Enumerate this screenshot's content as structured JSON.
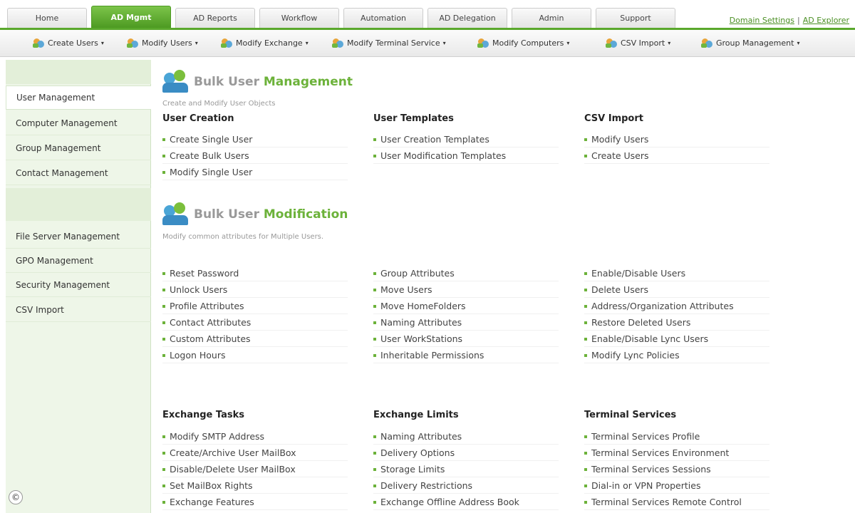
{
  "top_tabs": [
    {
      "label": "Home",
      "active": false
    },
    {
      "label": "AD Mgmt",
      "active": true
    },
    {
      "label": "AD Reports",
      "active": false
    },
    {
      "label": "Workflow",
      "active": false
    },
    {
      "label": "Automation",
      "active": false
    },
    {
      "label": "AD Delegation",
      "active": false
    },
    {
      "label": "Admin",
      "active": false
    },
    {
      "label": "Support",
      "active": false
    }
  ],
  "top_links": {
    "domain_settings": "Domain Settings",
    "separator": "|",
    "ad_explorer": "AD Explorer"
  },
  "toolbar": [
    {
      "label": "Create Users"
    },
    {
      "label": "Modify Users"
    },
    {
      "label": "Modify Exchange"
    },
    {
      "label": "Modify Terminal Service"
    },
    {
      "label": "Modify Computers"
    },
    {
      "label": "CSV Import"
    },
    {
      "label": "Group Management"
    }
  ],
  "caret": "▾",
  "sidebar": {
    "group1": [
      "User Management",
      "Computer Management",
      "Group Management",
      "Contact Management"
    ],
    "group2": [
      "File Server Management",
      "GPO Management",
      "Security Management",
      "CSV Import"
    ]
  },
  "section1": {
    "title_plain": "Bulk User ",
    "title_highlight": "Management",
    "subtitle": "Create and Modify User Objects",
    "columns": [
      {
        "heading": "User Creation",
        "links": [
          "Create Single User",
          "Create Bulk Users",
          "Modify Single User"
        ]
      },
      {
        "heading": "User Templates",
        "links": [
          "User Creation Templates",
          "User Modification Templates"
        ]
      },
      {
        "heading": "CSV Import",
        "links": [
          "Modify Users",
          "Create Users"
        ]
      }
    ]
  },
  "section2": {
    "title_plain": "Bulk User ",
    "title_highlight": "Modification",
    "subtitle": "Modify common attributes for Multiple Users.",
    "columns": [
      {
        "links": [
          "Reset Password",
          "Unlock Users",
          "Profile Attributes",
          "Contact Attributes",
          "Custom Attributes",
          "Logon Hours"
        ]
      },
      {
        "links": [
          "Group Attributes",
          "Move Users",
          "Move HomeFolders",
          "Naming Attributes",
          "User WorkStations",
          "Inheritable Permissions"
        ]
      },
      {
        "links": [
          "Enable/Disable Users",
          "Delete Users",
          "Address/Organization Attributes",
          "Restore Deleted Users",
          "Enable/Disable Lync Users",
          "Modify Lync Policies"
        ]
      }
    ]
  },
  "section3": {
    "columns": [
      {
        "heading": "Exchange Tasks",
        "links": [
          "Modify SMTP Address",
          "Create/Archive User MailBox",
          "Disable/Delete User MailBox",
          "Set MailBox Rights",
          "Exchange Features"
        ]
      },
      {
        "heading": "Exchange Limits",
        "links": [
          "Naming Attributes",
          "Delivery Options",
          "Storage Limits",
          "Delivery Restrictions",
          "Exchange Offline Address Book"
        ]
      },
      {
        "heading": "Terminal Services",
        "links": [
          "Terminal Services Profile",
          "Terminal Services Environment",
          "Terminal Services Sessions",
          "Dial-in or VPN Properties",
          "Terminal Services Remote Control"
        ]
      }
    ]
  },
  "copyright_symbol": "©",
  "colors": {
    "accent": "#5aa82c",
    "highlight": "#6cb23a"
  }
}
